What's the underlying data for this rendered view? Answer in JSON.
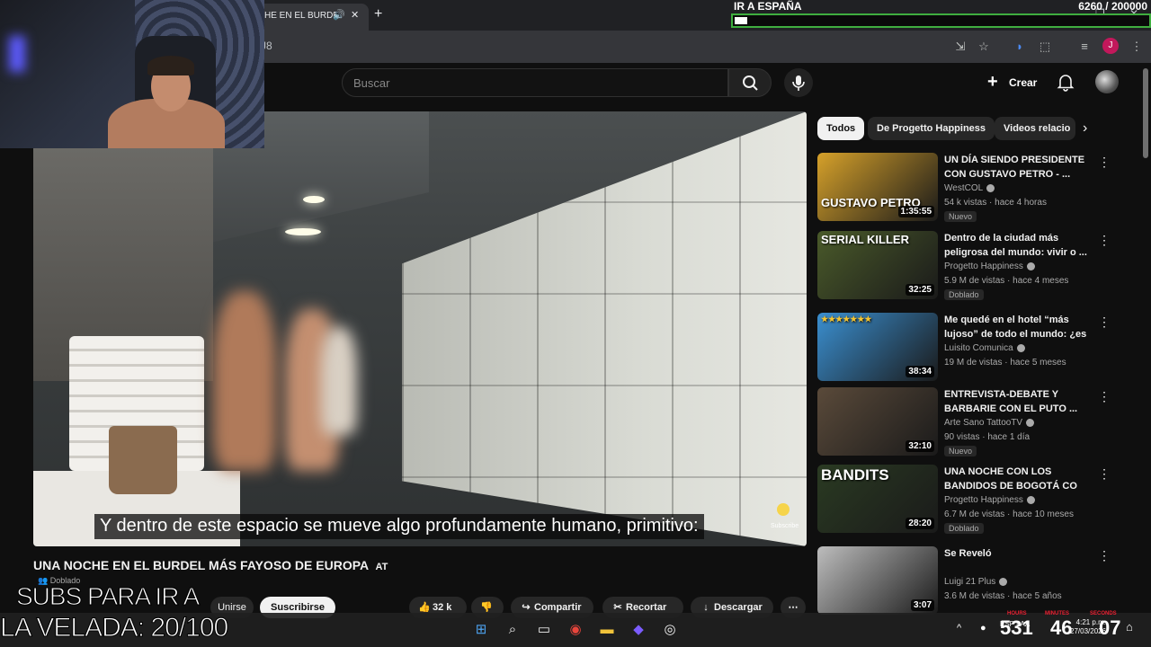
{
  "browser": {
    "tab_title": "HE EN EL BURDEL",
    "url_fragment": "J8"
  },
  "goal_overlay": {
    "label": "IR A ESPAÑA",
    "count_text": "6260 / 200000",
    "current": 6260,
    "target": 200000
  },
  "header": {
    "search_placeholder": "Buscar",
    "create_label": "Crear"
  },
  "player": {
    "caption": "Y dentro de este espacio se mueve algo profundamente humano, primitivo:",
    "subscribe_badge": "Subscribe"
  },
  "video": {
    "title": "UNA NOCHE EN EL BURDEL MÁS FAYOSO DE EUROPA",
    "title_badge": "AT",
    "dubbed": "Doblado",
    "join_label": "Unirse",
    "subscribe_label": "Suscribirse",
    "likes": "32 k",
    "share_label": "Compartir",
    "clip_label": "Recortar",
    "download_label": "Descargar"
  },
  "chips": [
    "Todos",
    "De Progetto Happiness",
    "Videos relacio"
  ],
  "related": [
    {
      "title": "UN DÍA SIENDO PRESIDENTE CON GUSTAVO PETRO - ...",
      "channel": "WestCOL",
      "meta": "54 k vistas · hace 4 horas",
      "badge": "Nuevo",
      "duration": "1:35:55",
      "thumb_text": "GUSTAVO PETRO",
      "thumb_bg": "#d6a12a"
    },
    {
      "title": "Dentro de la ciudad más peligrosa del mundo: vivir o ...",
      "channel": "Progetto Happiness",
      "meta": "5.9 M de vistas · hace 4 meses",
      "badge": "Doblado",
      "duration": "32:25",
      "thumb_text": "SERIAL KILLER",
      "thumb_bg": "#4a5a2a"
    },
    {
      "title": "Me quedé en el hotel “más lujoso” de todo el mundo: ¿es ...",
      "channel": "Luisito Comunica",
      "meta": "19 M de vistas · hace 5 meses",
      "badge": "",
      "duration": "38:34",
      "thumb_text": "★★★★★★★",
      "thumb_bg": "#3a8fd0"
    },
    {
      "title": "ENTREVISTA-DEBATE Y BARBARIE CON EL PUTO ...",
      "channel": "Arte Sano TattooTV",
      "meta": "90 vistas · hace 1 día",
      "badge": "Nuevo",
      "duration": "32:10",
      "thumb_text": "",
      "thumb_bg": "#5a4a3a"
    },
    {
      "title": "UNA NOCHE CON LOS BANDIDOS DE BOGOTÁ CO",
      "channel": "Progetto Happiness",
      "meta": "6.7 M de vistas · hace 10 meses",
      "badge": "Doblado",
      "duration": "28:20",
      "thumb_text": "BANDITS",
      "thumb_bg": "#2a3a22"
    },
    {
      "title": "Se Reveló",
      "channel": "Luigi 21 Plus",
      "meta": "3.6 M de vistas · hace 5 años",
      "badge": "",
      "duration": "3:07",
      "thumb_text": "",
      "thumb_bg": "#bdbdbd"
    }
  ],
  "stream_overlay": {
    "line1": "SUBS PARA IR A",
    "line2": "LA VELADA: 20/100"
  },
  "taskbar": {
    "clock_hours_label": "HOURS",
    "clock_minutes_label": "MINUTES",
    "clock_seconds_label": "SECONDS",
    "clock_h": "531",
    "clock_m": "46",
    "clock_s": "07",
    "time": "4:21 p.m.",
    "date": "27/03/2026",
    "lang": "ESP LAA"
  },
  "colors": {
    "accent_green": "#3fae3f",
    "bg": "#0f0f0f"
  }
}
